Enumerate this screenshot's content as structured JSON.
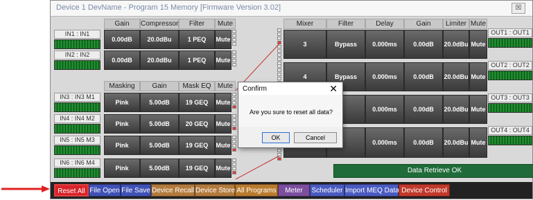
{
  "window": {
    "title": "Device 1 DevName  -  Program 15  Memory  [Firmware Version 3.02]",
    "close_glyph": "☒"
  },
  "left_headers_top": [
    "Gain",
    "Compressor",
    "Filter",
    "Mute"
  ],
  "left_headers_bottom": [
    "Masking",
    "Gain",
    "Mask EQ",
    "Mute"
  ],
  "inputs": [
    {
      "label": "IN1 : IN1",
      "c1": "0.00dB",
      "c2": "20.0dBu",
      "c3": "1 PEQ",
      "mute": "Mute"
    },
    {
      "label": "IN2 : IN2",
      "c1": "0.00dB",
      "c2": "20.0dBu",
      "c3": "1 PEQ",
      "mute": "Mute"
    },
    {
      "label": "IN3 : IN3 M1",
      "c1": "Pink",
      "c2": "5.00dB",
      "c3": "19 GEQ",
      "mute": "Mute"
    },
    {
      "label": "IN4 : IN4 M2",
      "c1": "Pink",
      "c2": "5.00dB",
      "c3": "20 GEQ",
      "mute": "Mute"
    },
    {
      "label": "IN5 : IN5 M3",
      "c1": "Pink",
      "c2": "5.00dB",
      "c3": "19 GEQ",
      "mute": "Mute"
    },
    {
      "label": "IN6 : IN6 M4",
      "c1": "Pink",
      "c2": "5.00dB",
      "c3": "19 GEQ",
      "mute": "Mute"
    }
  ],
  "right_headers": [
    "Mixer",
    "Filter",
    "Delay",
    "Gain",
    "Limiter",
    "Mute"
  ],
  "outputs": [
    {
      "mixer": "3",
      "filter": "Bypass",
      "delay": "0.000ms",
      "gain": "0.00dB",
      "limiter": "20.0dBu",
      "mute": "Mute",
      "label": "OUT1 : OUT1"
    },
    {
      "mixer": "4",
      "filter": "Bypass",
      "delay": "0.000ms",
      "gain": "0.00dB",
      "limiter": "20.0dBu",
      "mute": "Mute",
      "label": "OUT2 : OUT2"
    },
    {
      "mixer": "",
      "filter": "",
      "delay": "0.000ms",
      "gain": "0.00dB",
      "limiter": "20.0dBu",
      "mute": "Mute",
      "label": "OUT3 : OUT3"
    },
    {
      "mixer": "",
      "filter": "",
      "delay": "0.000ms",
      "gain": "0.00dB",
      "limiter": "20.0dBu",
      "mute": "Mute",
      "label": "OUT4 : OUT4"
    }
  ],
  "status": "Data Retrieve OK",
  "dialog": {
    "title": "Confirm",
    "close": "✕",
    "message": "Are you sure to reset all data?",
    "ok": "OK",
    "cancel": "Cancel"
  },
  "toolbar": [
    {
      "label": "Reset All",
      "color": "#d8232a"
    },
    {
      "label": "File Open",
      "color": "#3f51b5"
    },
    {
      "label": "File Save",
      "color": "#3f51b5"
    },
    {
      "label": "Device Recall",
      "color": "#b27a3c"
    },
    {
      "label": "Device Store",
      "color": "#b27a3c"
    },
    {
      "label": "All Programs",
      "color": "#b97b2e"
    },
    {
      "label": "Meter",
      "color": "#7b4e9e"
    },
    {
      "label": "Scheduler",
      "color": "#4a5bc0"
    },
    {
      "label": "Import MEQ Data",
      "color": "#4a5bc0"
    },
    {
      "label": "Device Control",
      "color": "#c0392b"
    }
  ],
  "annotation_arrow_color": "#e02020"
}
